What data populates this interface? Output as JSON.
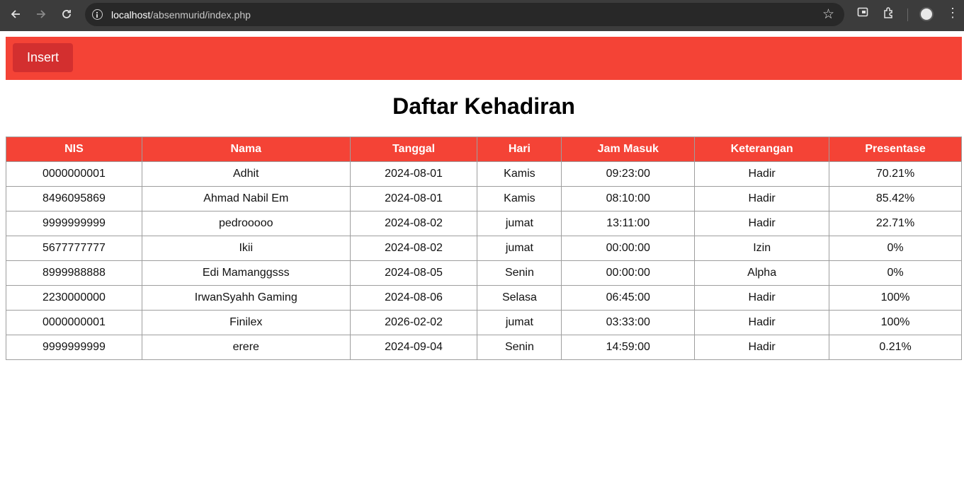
{
  "browser": {
    "url_host": "localhost",
    "url_path": "/absenmurid/index.php"
  },
  "toolbar": {
    "insert_label": "Insert"
  },
  "page": {
    "title": "Daftar Kehadiran"
  },
  "table": {
    "headers": [
      "NIS",
      "Nama",
      "Tanggal",
      "Hari",
      "Jam Masuk",
      "Keterangan",
      "Presentase"
    ],
    "rows": [
      [
        "0000000001",
        "Adhit",
        "2024-08-01",
        "Kamis",
        "09:23:00",
        "Hadir",
        "70.21%"
      ],
      [
        "8496095869",
        "Ahmad Nabil Em",
        "2024-08-01",
        "Kamis",
        "08:10:00",
        "Hadir",
        "85.42%"
      ],
      [
        "9999999999",
        "pedrooooo",
        "2024-08-02",
        "jumat",
        "13:11:00",
        "Hadir",
        "22.71%"
      ],
      [
        "5677777777",
        "Ikii",
        "2024-08-02",
        "jumat",
        "00:00:00",
        "Izin",
        "0%"
      ],
      [
        "8999988888",
        "Edi Mamanggsss",
        "2024-08-05",
        "Senin",
        "00:00:00",
        "Alpha",
        "0%"
      ],
      [
        "2230000000",
        "IrwanSyahh Gaming",
        "2024-08-06",
        "Selasa",
        "06:45:00",
        "Hadir",
        "100%"
      ],
      [
        "0000000001",
        "Finilex",
        "2026-02-02",
        "jumat",
        "03:33:00",
        "Hadir",
        "100%"
      ],
      [
        "9999999999",
        "erere",
        "2024-09-04",
        "Senin",
        "14:59:00",
        "Hadir",
        "0.21%"
      ]
    ]
  },
  "colors": {
    "header_bar": "#f44336",
    "insert_button": "#d32f2f",
    "table_header": "#f44336"
  },
  "icons": [
    "back-icon",
    "forward-icon",
    "reload-icon",
    "site-info-icon",
    "bookmark-star-icon",
    "tab-search-icon",
    "extensions-icon",
    "profile-avatar-icon",
    "more-menu-icon"
  ]
}
